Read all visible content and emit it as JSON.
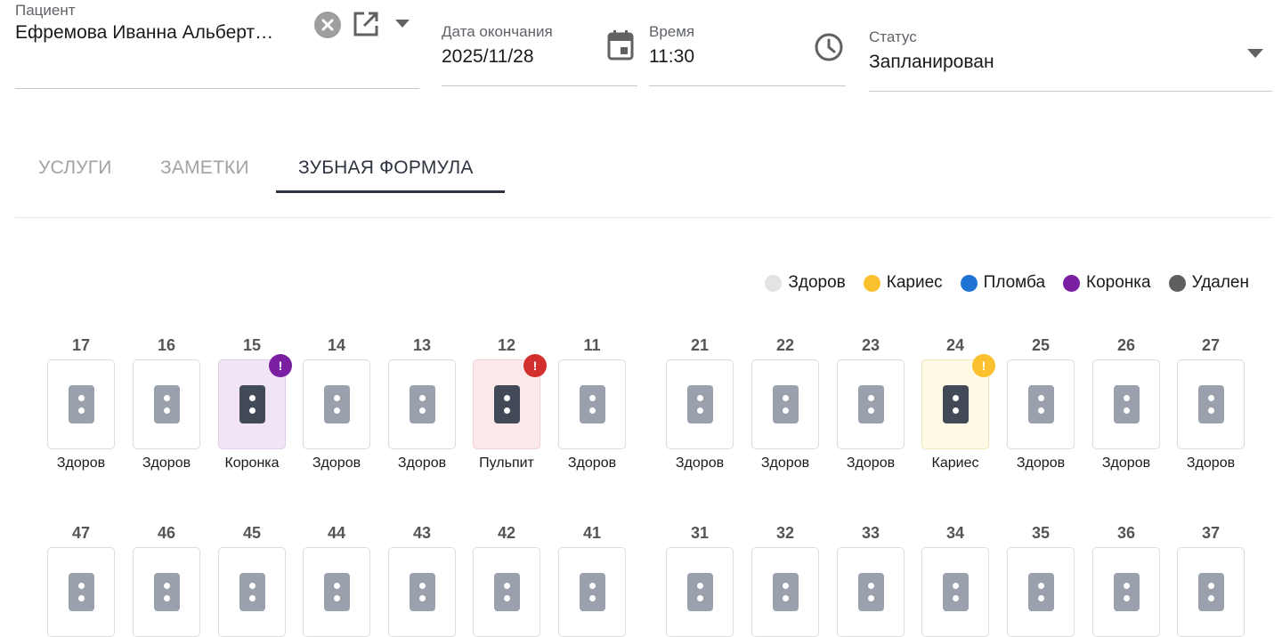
{
  "patient": {
    "label": "Пациент",
    "value": "Ефремова Иванна Альберт…"
  },
  "end_date": {
    "label": "Дата окончания",
    "value": "2025/11/28"
  },
  "time": {
    "label": "Время",
    "value": "11:30"
  },
  "status": {
    "label": "Статус",
    "value": "Запланирован"
  },
  "tabs": [
    {
      "label": "УСЛУГИ",
      "active": false
    },
    {
      "label": "ЗАМЕТКИ",
      "active": false
    },
    {
      "label": "ЗУБНАЯ ФОРМУЛА",
      "active": true
    }
  ],
  "legend": [
    {
      "label": "Здоров",
      "color": "#e3e3e3"
    },
    {
      "label": "Кариес",
      "color": "#fbc02d"
    },
    {
      "label": "Пломба",
      "color": "#1e73d2"
    },
    {
      "label": "Коронка",
      "color": "#7b1fa2"
    },
    {
      "label": "Удален",
      "color": "#5f5f5f"
    }
  ],
  "upper_teeth": [
    {
      "number": "17",
      "status": "Здоров"
    },
    {
      "number": "16",
      "status": "Здоров"
    },
    {
      "number": "15",
      "status": "Коронка",
      "badge": "!",
      "badge_color": "#7b1fa2"
    },
    {
      "number": "14",
      "status": "Здоров"
    },
    {
      "number": "13",
      "status": "Здоров"
    },
    {
      "number": "12",
      "status": "Пульпит",
      "badge": "!",
      "badge_color": "#d32f2f"
    },
    {
      "number": "11",
      "status": "Здоров"
    },
    {
      "number": "21",
      "status": "Здоров"
    },
    {
      "number": "22",
      "status": "Здоров"
    },
    {
      "number": "23",
      "status": "Здоров"
    },
    {
      "number": "24",
      "status": "Кариес",
      "badge": "!",
      "badge_color": "#fbc02d"
    },
    {
      "number": "25",
      "status": "Здоров"
    },
    {
      "number": "26",
      "status": "Здоров"
    },
    {
      "number": "27",
      "status": "Здоров"
    }
  ],
  "lower_teeth": [
    {
      "number": "47"
    },
    {
      "number": "46"
    },
    {
      "number": "45"
    },
    {
      "number": "44"
    },
    {
      "number": "43"
    },
    {
      "number": "42"
    },
    {
      "number": "41"
    },
    {
      "number": "31"
    },
    {
      "number": "32"
    },
    {
      "number": "33"
    },
    {
      "number": "34"
    },
    {
      "number": "35"
    },
    {
      "number": "36"
    },
    {
      "number": "37"
    }
  ]
}
